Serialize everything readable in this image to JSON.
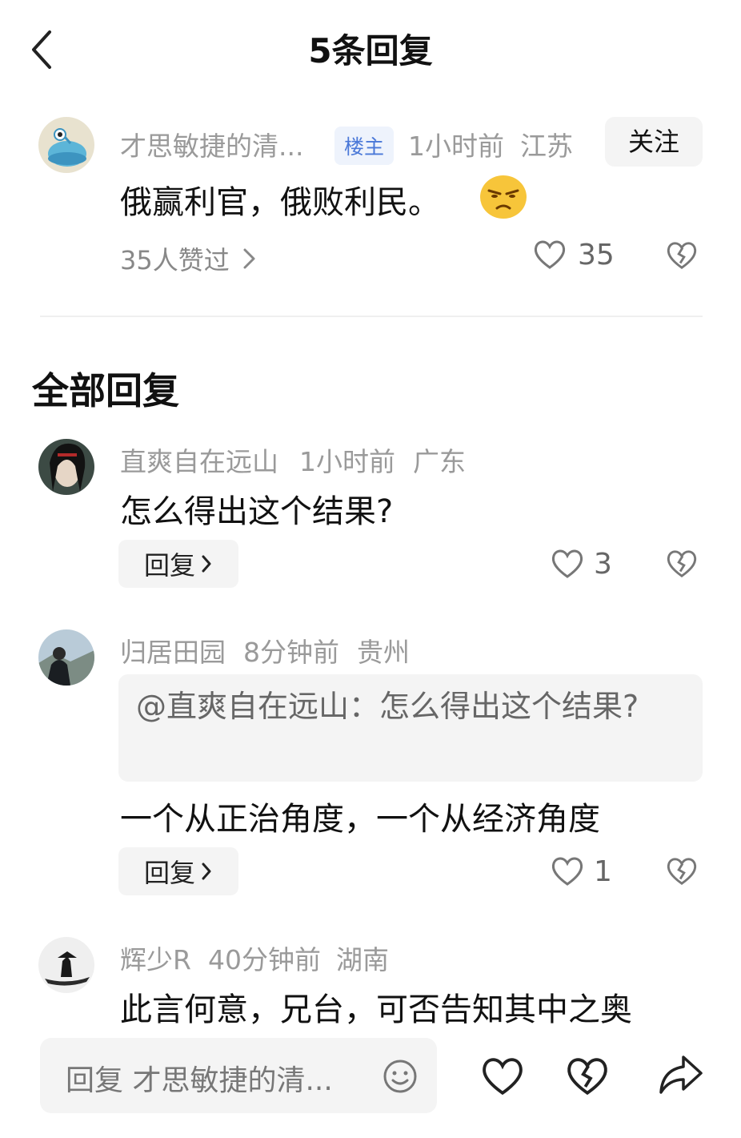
{
  "header": {
    "title": "5条回复",
    "back_icon": "chevron-left-icon"
  },
  "main_comment": {
    "username": "才思敏捷的清...",
    "badge": "楼主",
    "time": "1小时前",
    "location": "江苏",
    "follow_label": "关注",
    "text": "俄赢利官，俄败利民。",
    "emoji": "annoyed-face-emoji",
    "likers_text": "35人赞过",
    "like_count": "35"
  },
  "section_title": "全部回复",
  "replies": [
    {
      "username": "直爽自在远山",
      "time": "1小时前",
      "location": "广东",
      "text": "怎么得出这个结果?",
      "reply_label": "回复",
      "like_count": "3"
    },
    {
      "username": "归居田园",
      "time": "8分钟前",
      "location": "贵州",
      "quote": "@直爽自在远山：怎么得出这个结果?",
      "text": "一个从正治角度，一个从经济角度",
      "reply_label": "回复",
      "like_count": "1"
    },
    {
      "username": "辉少R",
      "time": "40分钟前",
      "location": "湖南",
      "text": "此言何意，兄台，可否告知其中之奥"
    }
  ],
  "bottom_bar": {
    "input_placeholder": "回复 才思敏捷的清...",
    "icons": [
      "emoji-icon",
      "like-icon",
      "dislike-icon",
      "share-icon"
    ]
  },
  "colors": {
    "badge_text": "#4a78d8",
    "badge_bg": "#eef3fc",
    "muted": "#9a9a9a"
  }
}
